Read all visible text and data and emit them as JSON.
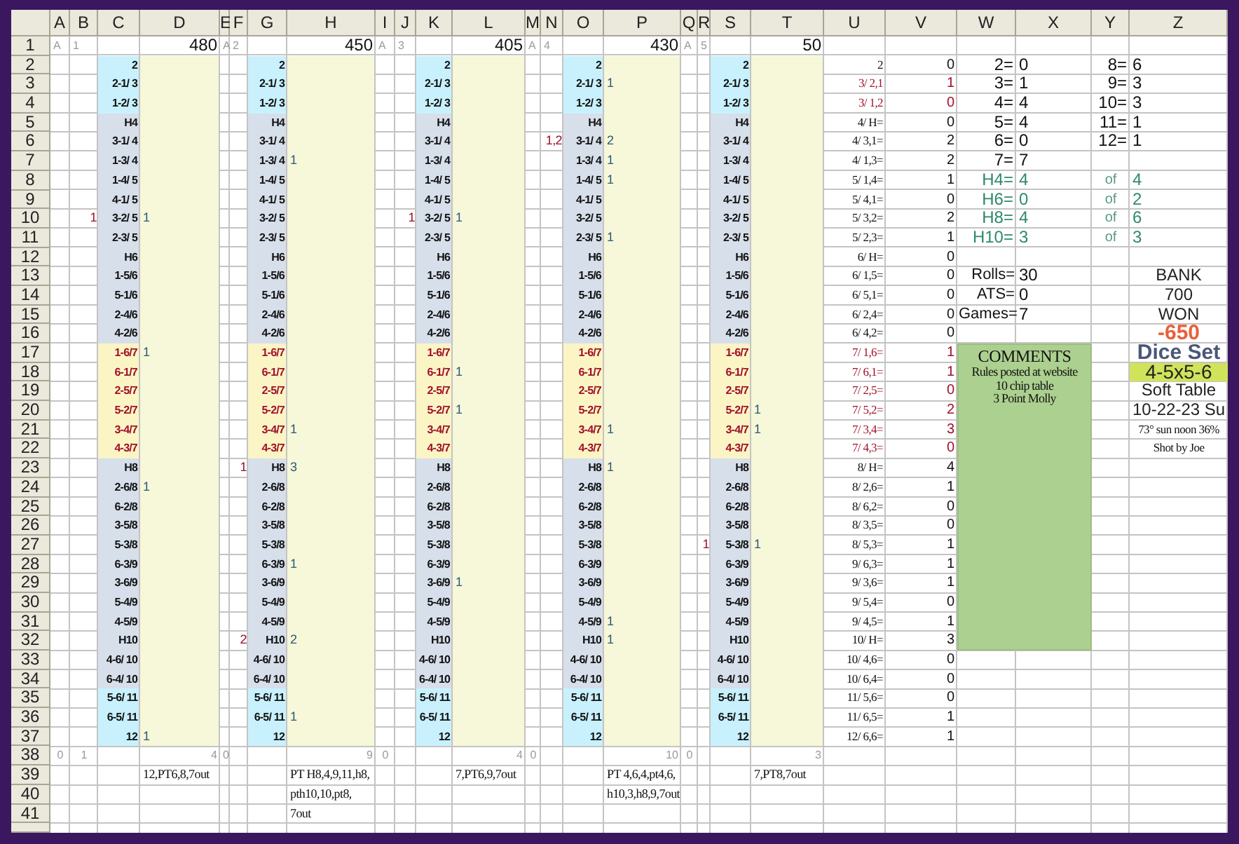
{
  "sheet": {
    "columns": [
      "A",
      "B",
      "C",
      "D",
      "E",
      "F",
      "G",
      "H",
      "I",
      "J",
      "K",
      "L",
      "M",
      "N",
      "O",
      "P",
      "Q",
      "R",
      "S",
      "T",
      "U",
      "V",
      "W",
      "X",
      "Y",
      "Z"
    ],
    "row_numbers": [
      "1",
      "2",
      "3",
      "4",
      "5",
      "6",
      "7",
      "8",
      "9",
      "10",
      "11",
      "12",
      "13",
      "14",
      "15",
      "16",
      "17",
      "18",
      "19",
      "20",
      "21",
      "22",
      "23",
      "24",
      "25",
      "26",
      "27",
      "28",
      "29",
      "30",
      "31",
      "32",
      "33",
      "34",
      "35",
      "36",
      "37",
      "38",
      "39",
      "40",
      "41"
    ],
    "blocks": [
      {
        "marker": "A",
        "game": "1",
        "total": "480",
        "rolls": [
          {
            "label": "2",
            "kind": "outer"
          },
          {
            "label": "2-1/ 3",
            "kind": "outer"
          },
          {
            "label": "1-2/ 3",
            "kind": "outer"
          },
          {
            "label": "H4",
            "kind": "inner"
          },
          {
            "label": "3-1/ 4",
            "kind": "inner"
          },
          {
            "label": "1-3/ 4",
            "kind": "inner"
          },
          {
            "label": "1-4/ 5",
            "kind": "inner"
          },
          {
            "label": "4-1/ 5",
            "kind": "inner"
          },
          {
            "label": "3-2/ 5",
            "kind": "inner",
            "miss": "1",
            "hit": "1"
          },
          {
            "label": "2-3/ 5",
            "kind": "inner"
          },
          {
            "label": "H6",
            "kind": "inner"
          },
          {
            "label": "1-5/6",
            "kind": "inner"
          },
          {
            "label": "5-1/6",
            "kind": "inner"
          },
          {
            "label": "2-4/6",
            "kind": "inner"
          },
          {
            "label": "4-2/6",
            "kind": "inner"
          },
          {
            "label": "1-6/7",
            "kind": "seven",
            "hit": "1"
          },
          {
            "label": "6-1/7",
            "kind": "seven"
          },
          {
            "label": "2-5/7",
            "kind": "seven"
          },
          {
            "label": "5-2/7",
            "kind": "seven"
          },
          {
            "label": "3-4/7",
            "kind": "seven"
          },
          {
            "label": "4-3/7",
            "kind": "seven"
          },
          {
            "label": "H8",
            "kind": "inner"
          },
          {
            "label": "2-6/8",
            "kind": "inner",
            "hit": "1"
          },
          {
            "label": "6-2/8",
            "kind": "inner"
          },
          {
            "label": "3-5/8",
            "kind": "inner"
          },
          {
            "label": "5-3/8",
            "kind": "inner"
          },
          {
            "label": "6-3/9",
            "kind": "inner"
          },
          {
            "label": "3-6/9",
            "kind": "inner"
          },
          {
            "label": "5-4/9",
            "kind": "inner"
          },
          {
            "label": "4-5/9",
            "kind": "inner"
          },
          {
            "label": "H10",
            "kind": "inner"
          },
          {
            "label": "4-6/ 10",
            "kind": "inner"
          },
          {
            "label": "6-4/ 10",
            "kind": "inner"
          },
          {
            "label": "5-6/ 11",
            "kind": "outer"
          },
          {
            "label": "6-5/ 11",
            "kind": "outer"
          },
          {
            "label": "12",
            "kind": "outer",
            "hit": "1"
          }
        ],
        "tally": {
          "flag": "0",
          "game": "1",
          "total": "4"
        },
        "notes": [
          "12,PT6,8,7out"
        ]
      },
      {
        "marker": "A",
        "game": "2",
        "total": "450",
        "rolls": [
          {
            "label": "2",
            "kind": "outer"
          },
          {
            "label": "2-1/ 3",
            "kind": "outer"
          },
          {
            "label": "1-2/ 3",
            "kind": "outer"
          },
          {
            "label": "H4",
            "kind": "inner"
          },
          {
            "label": "3-1/ 4",
            "kind": "inner"
          },
          {
            "label": "1-3/ 4",
            "kind": "inner",
            "hit": "1"
          },
          {
            "label": "1-4/ 5",
            "kind": "inner"
          },
          {
            "label": "4-1/ 5",
            "kind": "inner"
          },
          {
            "label": "3-2/ 5",
            "kind": "inner"
          },
          {
            "label": "2-3/ 5",
            "kind": "inner"
          },
          {
            "label": "H6",
            "kind": "inner"
          },
          {
            "label": "1-5/6",
            "kind": "inner"
          },
          {
            "label": "5-1/6",
            "kind": "inner"
          },
          {
            "label": "2-4/6",
            "kind": "inner"
          },
          {
            "label": "4-2/6",
            "kind": "inner"
          },
          {
            "label": "1-6/7",
            "kind": "seven"
          },
          {
            "label": "6-1/7",
            "kind": "seven"
          },
          {
            "label": "2-5/7",
            "kind": "seven"
          },
          {
            "label": "5-2/7",
            "kind": "seven"
          },
          {
            "label": "3-4/7",
            "kind": "seven",
            "hit": "1"
          },
          {
            "label": "4-3/7",
            "kind": "seven"
          },
          {
            "label": "H8",
            "kind": "inner",
            "miss": "1",
            "hit": "3"
          },
          {
            "label": "2-6/8",
            "kind": "inner"
          },
          {
            "label": "6-2/8",
            "kind": "inner"
          },
          {
            "label": "3-5/8",
            "kind": "inner"
          },
          {
            "label": "5-3/8",
            "kind": "inner"
          },
          {
            "label": "6-3/9",
            "kind": "inner",
            "hit": "1"
          },
          {
            "label": "3-6/9",
            "kind": "inner"
          },
          {
            "label": "5-4/9",
            "kind": "inner"
          },
          {
            "label": "4-5/9",
            "kind": "inner"
          },
          {
            "label": "H10",
            "kind": "inner",
            "miss": "2",
            "hit": "2"
          },
          {
            "label": "4-6/ 10",
            "kind": "inner"
          },
          {
            "label": "6-4/ 10",
            "kind": "inner"
          },
          {
            "label": "5-6/ 11",
            "kind": "outer"
          },
          {
            "label": "6-5/ 11",
            "kind": "outer",
            "hit": "1"
          },
          {
            "label": "12",
            "kind": "outer"
          }
        ],
        "tally": {
          "flag": "0",
          "total": "9"
        },
        "notes": [
          "PT H8,4,9,11,h8,",
          "pth10,10,pt8,",
          "7out"
        ]
      },
      {
        "marker": "A",
        "game": "3",
        "total": "405",
        "rolls": [
          {
            "label": "2",
            "kind": "outer"
          },
          {
            "label": "2-1/ 3",
            "kind": "outer"
          },
          {
            "label": "1-2/ 3",
            "kind": "outer"
          },
          {
            "label": "H4",
            "kind": "inner"
          },
          {
            "label": "3-1/ 4",
            "kind": "inner"
          },
          {
            "label": "1-3/ 4",
            "kind": "inner"
          },
          {
            "label": "1-4/ 5",
            "kind": "inner"
          },
          {
            "label": "4-1/ 5",
            "kind": "inner"
          },
          {
            "label": "3-2/ 5",
            "kind": "inner",
            "miss": "1",
            "hit": "1"
          },
          {
            "label": "2-3/ 5",
            "kind": "inner"
          },
          {
            "label": "H6",
            "kind": "inner"
          },
          {
            "label": "1-5/6",
            "kind": "inner"
          },
          {
            "label": "5-1/6",
            "kind": "inner"
          },
          {
            "label": "2-4/6",
            "kind": "inner"
          },
          {
            "label": "4-2/6",
            "kind": "inner"
          },
          {
            "label": "1-6/7",
            "kind": "seven"
          },
          {
            "label": "6-1/7",
            "kind": "seven",
            "hit": "1"
          },
          {
            "label": "2-5/7",
            "kind": "seven"
          },
          {
            "label": "5-2/7",
            "kind": "seven",
            "hit": "1"
          },
          {
            "label": "3-4/7",
            "kind": "seven"
          },
          {
            "label": "4-3/7",
            "kind": "seven"
          },
          {
            "label": "H8",
            "kind": "inner"
          },
          {
            "label": "2-6/8",
            "kind": "inner"
          },
          {
            "label": "6-2/8",
            "kind": "inner"
          },
          {
            "label": "3-5/8",
            "kind": "inner"
          },
          {
            "label": "5-3/8",
            "kind": "inner"
          },
          {
            "label": "6-3/9",
            "kind": "inner"
          },
          {
            "label": "3-6/9",
            "kind": "inner",
            "hit": "1"
          },
          {
            "label": "5-4/9",
            "kind": "inner"
          },
          {
            "label": "4-5/9",
            "kind": "inner"
          },
          {
            "label": "H10",
            "kind": "inner"
          },
          {
            "label": "4-6/ 10",
            "kind": "inner"
          },
          {
            "label": "6-4/ 10",
            "kind": "inner"
          },
          {
            "label": "5-6/ 11",
            "kind": "outer"
          },
          {
            "label": "6-5/ 11",
            "kind": "outer"
          },
          {
            "label": "12",
            "kind": "outer"
          }
        ],
        "tally": {
          "flag": "0",
          "total": "4"
        },
        "notes": [
          "7,PT6,9,7out"
        ]
      },
      {
        "marker": "A",
        "game": "4",
        "total": "430",
        "rolls": [
          {
            "label": "2",
            "kind": "outer"
          },
          {
            "label": "2-1/ 3",
            "kind": "outer",
            "hit": "1"
          },
          {
            "label": "1-2/ 3",
            "kind": "outer"
          },
          {
            "label": "H4",
            "kind": "inner"
          },
          {
            "label": "3-1/ 4",
            "kind": "inner",
            "miss": "1,2",
            "hit": "2"
          },
          {
            "label": "1-3/ 4",
            "kind": "inner",
            "hit": "1"
          },
          {
            "label": "1-4/ 5",
            "kind": "inner",
            "hit": "1"
          },
          {
            "label": "4-1/ 5",
            "kind": "inner"
          },
          {
            "label": "3-2/ 5",
            "kind": "inner"
          },
          {
            "label": "2-3/ 5",
            "kind": "inner",
            "hit": "1"
          },
          {
            "label": "H6",
            "kind": "inner"
          },
          {
            "label": "1-5/6",
            "kind": "inner"
          },
          {
            "label": "5-1/6",
            "kind": "inner"
          },
          {
            "label": "2-4/6",
            "kind": "inner"
          },
          {
            "label": "4-2/6",
            "kind": "inner"
          },
          {
            "label": "1-6/7",
            "kind": "seven"
          },
          {
            "label": "6-1/7",
            "kind": "seven"
          },
          {
            "label": "2-5/7",
            "kind": "seven"
          },
          {
            "label": "5-2/7",
            "kind": "seven"
          },
          {
            "label": "3-4/7",
            "kind": "seven",
            "hit": "1"
          },
          {
            "label": "4-3/7",
            "kind": "seven"
          },
          {
            "label": "H8",
            "kind": "inner",
            "hit": "1"
          },
          {
            "label": "2-6/8",
            "kind": "inner"
          },
          {
            "label": "6-2/8",
            "kind": "inner"
          },
          {
            "label": "3-5/8",
            "kind": "inner"
          },
          {
            "label": "5-3/8",
            "kind": "inner"
          },
          {
            "label": "6-3/9",
            "kind": "inner"
          },
          {
            "label": "3-6/9",
            "kind": "inner"
          },
          {
            "label": "5-4/9",
            "kind": "inner"
          },
          {
            "label": "4-5/9",
            "kind": "inner",
            "hit": "1"
          },
          {
            "label": "H10",
            "kind": "inner",
            "hit": "1"
          },
          {
            "label": "4-6/ 10",
            "kind": "inner"
          },
          {
            "label": "6-4/ 10",
            "kind": "inner"
          },
          {
            "label": "5-6/ 11",
            "kind": "outer"
          },
          {
            "label": "6-5/ 11",
            "kind": "outer"
          },
          {
            "label": "12",
            "kind": "outer"
          }
        ],
        "tally": {
          "flag": "0",
          "total": "10"
        },
        "notes": [
          "PT 4,6,4,pt4,6,",
          "h10,3,h8,9,7out"
        ]
      },
      {
        "marker": "A",
        "game": "5",
        "total": "50",
        "rolls": [
          {
            "label": "2",
            "kind": "outer"
          },
          {
            "label": "2-1/ 3",
            "kind": "outer"
          },
          {
            "label": "1-2/ 3",
            "kind": "outer"
          },
          {
            "label": "H4",
            "kind": "inner"
          },
          {
            "label": "3-1/ 4",
            "kind": "inner"
          },
          {
            "label": "1-3/ 4",
            "kind": "inner"
          },
          {
            "label": "1-4/ 5",
            "kind": "inner"
          },
          {
            "label": "4-1/ 5",
            "kind": "inner"
          },
          {
            "label": "3-2/ 5",
            "kind": "inner"
          },
          {
            "label": "2-3/ 5",
            "kind": "inner"
          },
          {
            "label": "H6",
            "kind": "inner"
          },
          {
            "label": "1-5/6",
            "kind": "inner"
          },
          {
            "label": "5-1/6",
            "kind": "inner"
          },
          {
            "label": "2-4/6",
            "kind": "inner"
          },
          {
            "label": "4-2/6",
            "kind": "inner"
          },
          {
            "label": "1-6/7",
            "kind": "seven"
          },
          {
            "label": "6-1/7",
            "kind": "seven"
          },
          {
            "label": "2-5/7",
            "kind": "seven"
          },
          {
            "label": "5-2/7",
            "kind": "seven",
            "hit": "1"
          },
          {
            "label": "3-4/7",
            "kind": "seven",
            "hit": "1"
          },
          {
            "label": "4-3/7",
            "kind": "seven"
          },
          {
            "label": "H8",
            "kind": "inner"
          },
          {
            "label": "2-6/8",
            "kind": "inner"
          },
          {
            "label": "6-2/8",
            "kind": "inner"
          },
          {
            "label": "3-5/8",
            "kind": "inner"
          },
          {
            "label": "5-3/8",
            "kind": "inner",
            "miss": "1",
            "hit": "1"
          },
          {
            "label": "6-3/9",
            "kind": "inner"
          },
          {
            "label": "3-6/9",
            "kind": "inner"
          },
          {
            "label": "5-4/9",
            "kind": "inner"
          },
          {
            "label": "4-5/9",
            "kind": "inner"
          },
          {
            "label": "H10",
            "kind": "inner"
          },
          {
            "label": "4-6/ 10",
            "kind": "inner"
          },
          {
            "label": "6-4/ 10",
            "kind": "inner"
          },
          {
            "label": "5-6/ 11",
            "kind": "outer"
          },
          {
            "label": "6-5/ 11",
            "kind": "outer"
          },
          {
            "label": "12",
            "kind": "outer"
          }
        ],
        "tally": {
          "flag": "0",
          "total": "3"
        },
        "notes": [
          "7,PT8,7out"
        ]
      }
    ],
    "summary": [
      {
        "label": "2",
        "count": "0",
        "kind": "plain"
      },
      {
        "label": "3/ 2,1",
        "count": "1",
        "kind": "alert"
      },
      {
        "label": "3/ 1,2",
        "count": "0",
        "kind": "alert"
      },
      {
        "label": "4/ H=",
        "count": "0",
        "kind": "plain"
      },
      {
        "label": "4/ 3,1=",
        "count": "2",
        "kind": "plain"
      },
      {
        "label": "4/ 1,3=",
        "count": "2",
        "kind": "plain"
      },
      {
        "label": "5/ 1,4=",
        "count": "1",
        "kind": "plain"
      },
      {
        "label": "5/ 4,1=",
        "count": "0",
        "kind": "plain"
      },
      {
        "label": "5/ 3,2=",
        "count": "2",
        "kind": "plain"
      },
      {
        "label": "5/ 2,3=",
        "count": "1",
        "kind": "plain"
      },
      {
        "label": "6/ H=",
        "count": "0",
        "kind": "plain"
      },
      {
        "label": "6/ 1,5=",
        "count": "0",
        "kind": "plain"
      },
      {
        "label": "6/ 5,1=",
        "count": "0",
        "kind": "plain"
      },
      {
        "label": "6/ 2,4=",
        "count": "0",
        "kind": "plain"
      },
      {
        "label": "6/ 4,2=",
        "count": "0",
        "kind": "plain"
      },
      {
        "label": "7/ 1,6=",
        "count": "1",
        "kind": "alert"
      },
      {
        "label": "7/ 6,1=",
        "count": "1",
        "kind": "alert"
      },
      {
        "label": "7/ 2,5=",
        "count": "0",
        "kind": "alert"
      },
      {
        "label": "7/ 5,2=",
        "count": "2",
        "kind": "alert"
      },
      {
        "label": "7/ 3,4=",
        "count": "3",
        "kind": "alert"
      },
      {
        "label": "7/ 4,3=",
        "count": "0",
        "kind": "alert"
      },
      {
        "label": "8/ H=",
        "count": "4",
        "kind": "plain"
      },
      {
        "label": "8/ 2,6=",
        "count": "1",
        "kind": "plain"
      },
      {
        "label": "8/ 6,2=",
        "count": "0",
        "kind": "plain"
      },
      {
        "label": "8/ 3,5=",
        "count": "0",
        "kind": "plain"
      },
      {
        "label": "8/ 5,3=",
        "count": "1",
        "kind": "plain"
      },
      {
        "label": "9/ 6,3=",
        "count": "1",
        "kind": "plain"
      },
      {
        "label": "9/ 3,6=",
        "count": "1",
        "kind": "plain"
      },
      {
        "label": "9/ 5,4=",
        "count": "0",
        "kind": "plain"
      },
      {
        "label": "9/ 4,5=",
        "count": "1",
        "kind": "plain"
      },
      {
        "label": "10/ H=",
        "count": "3",
        "kind": "plain"
      },
      {
        "label": "10/ 4,6=",
        "count": "0",
        "kind": "plain"
      },
      {
        "label": "10/ 6,4=",
        "count": "0",
        "kind": "plain"
      },
      {
        "label": "11/ 5,6=",
        "count": "0",
        "kind": "plain"
      },
      {
        "label": "11/ 6,5=",
        "count": "1",
        "kind": "plain"
      },
      {
        "label": "12/ 6,6=",
        "count": "1",
        "kind": "plain"
      }
    ],
    "sums": [
      {
        "label": "2=",
        "value": "0",
        "kind": "sum"
      },
      {
        "label": "3=",
        "value": "1",
        "kind": "sum"
      },
      {
        "label": "4=",
        "value": "4",
        "kind": "sum"
      },
      {
        "label": "5=",
        "value": "4",
        "kind": "sum"
      },
      {
        "label": "6=",
        "value": "0",
        "kind": "sum"
      },
      {
        "label": "7=",
        "value": "7",
        "kind": "sum"
      },
      {
        "label": "H4=",
        "value": "4",
        "kind": "hard"
      },
      {
        "label": "H6=",
        "value": "0",
        "kind": "hard"
      },
      {
        "label": "H8=",
        "value": "4",
        "kind": "hard"
      },
      {
        "label": "H10=",
        "value": "3",
        "kind": "hard"
      }
    ],
    "sums_right": [
      {
        "label": "8=",
        "value": "6"
      },
      {
        "label": "9=",
        "value": "3"
      },
      {
        "label": "10=",
        "value": "3"
      },
      {
        "label": "11=",
        "value": "1"
      },
      {
        "label": "12=",
        "value": "1"
      }
    ],
    "of": [
      {
        "label": "of",
        "value": "4"
      },
      {
        "label": "of",
        "value": "2"
      },
      {
        "label": "of",
        "value": "6"
      },
      {
        "label": "of",
        "value": "3"
      }
    ],
    "stats": [
      {
        "label": "Rolls=",
        "value": "30"
      },
      {
        "label": "ATS=",
        "value": "0"
      },
      {
        "label": "Games=",
        "value": "7"
      }
    ],
    "panel": [
      {
        "text": "BANK",
        "kind": "caption"
      },
      {
        "text": "700",
        "kind": "caption"
      },
      {
        "text": "WON",
        "kind": "caption"
      },
      {
        "text": "-650",
        "kind": "result"
      },
      {
        "text": "Dice Set",
        "kind": "heading"
      },
      {
        "text": "4-5x5-6",
        "kind": "highlight"
      },
      {
        "text": "Soft Table",
        "kind": "caption"
      },
      {
        "text": "10-22-23 Su",
        "kind": "caption"
      },
      {
        "text": "73° sun noon 36%",
        "kind": "small"
      },
      {
        "text": "Shot by Joe",
        "kind": "small"
      }
    ],
    "comments": {
      "title": "COMMENTS",
      "lines": [
        "Rules posted at website",
        "10 chip table",
        "3 Point Molly"
      ]
    }
  }
}
